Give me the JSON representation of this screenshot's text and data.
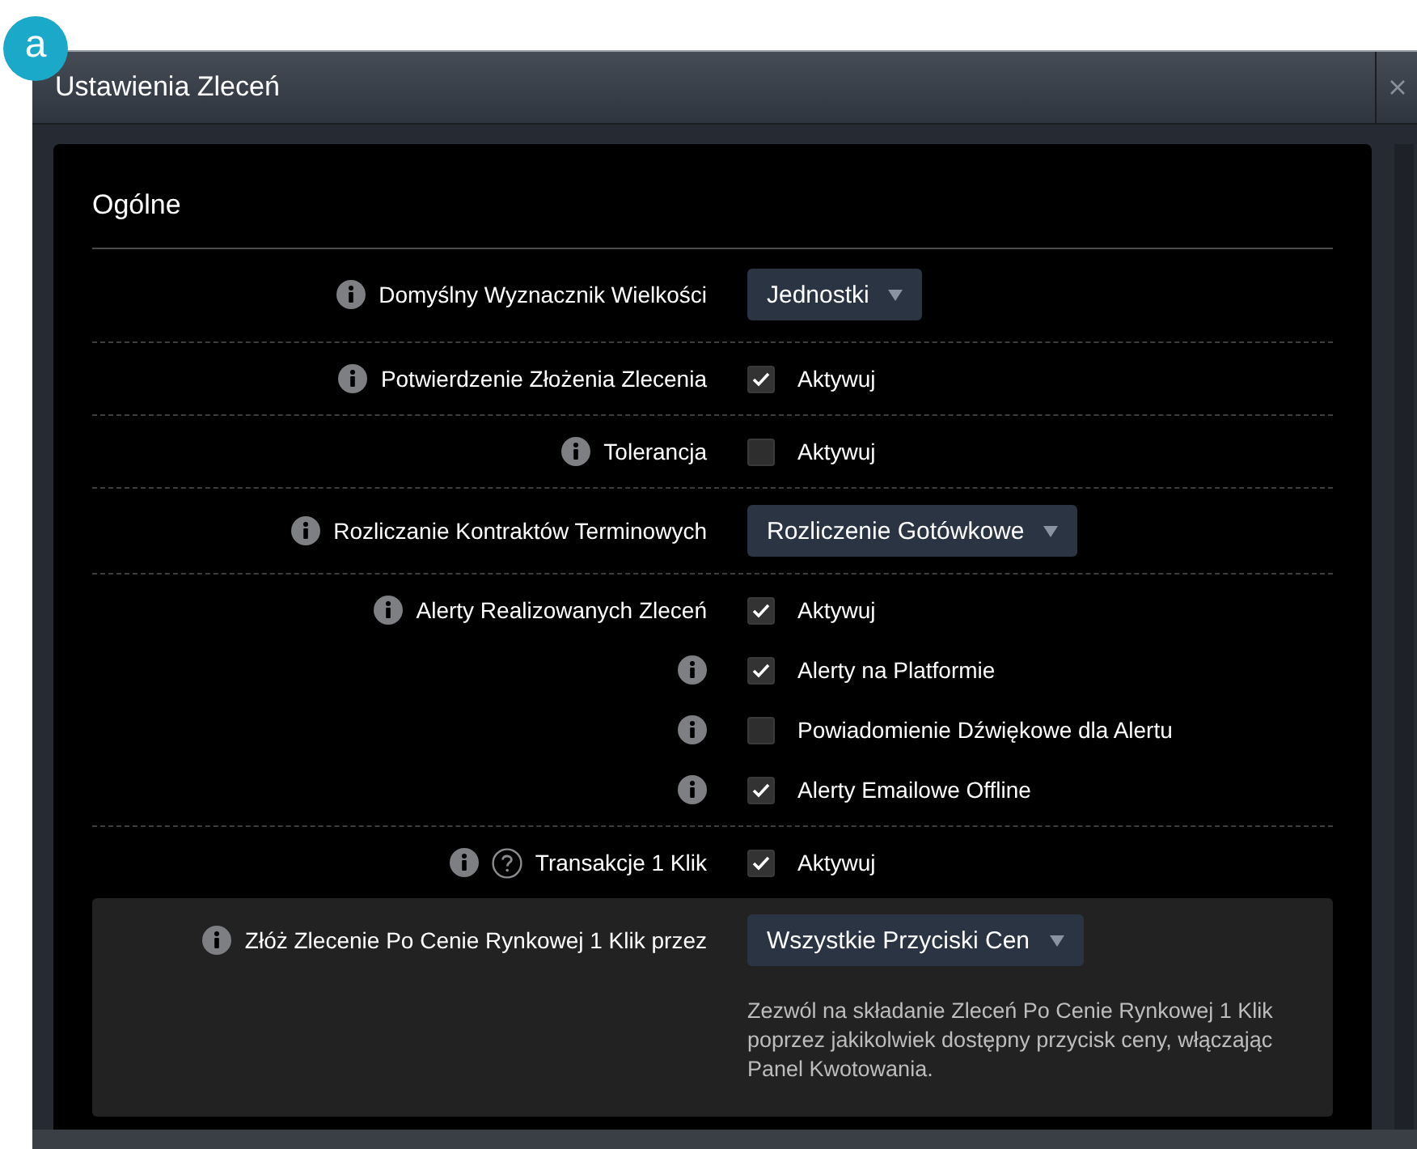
{
  "badge": "a",
  "window": {
    "title": "Ustawienia Zleceń"
  },
  "section": {
    "title": "Ogólne"
  },
  "groups": [
    {
      "highlighted": false,
      "items": [
        {
          "kind": "select",
          "label": "Domyślny Wyznacznik Wielkości",
          "info": true,
          "help": false,
          "value": "Jednostki"
        }
      ]
    },
    {
      "highlighted": false,
      "items": [
        {
          "kind": "checkbox",
          "label": "Potwierdzenie Złożenia Zlecenia",
          "info": true,
          "help": false,
          "checked": true,
          "text": "Aktywuj"
        }
      ]
    },
    {
      "highlighted": false,
      "items": [
        {
          "kind": "checkbox",
          "label": "Tolerancja",
          "info": true,
          "help": false,
          "checked": false,
          "text": "Aktywuj"
        }
      ]
    },
    {
      "highlighted": false,
      "items": [
        {
          "kind": "select",
          "label": "Rozliczanie Kontraktów Terminowych",
          "info": true,
          "help": false,
          "value": "Rozliczenie Gotówkowe"
        }
      ]
    },
    {
      "highlighted": false,
      "items": [
        {
          "kind": "checkbox",
          "label": "Alerty Realizowanych Zleceń",
          "info": true,
          "help": false,
          "checked": true,
          "text": "Aktywuj"
        },
        {
          "kind": "checkbox",
          "info": true,
          "help": false,
          "checked": true,
          "text": "Alerty na Platformie"
        },
        {
          "kind": "checkbox",
          "info": true,
          "help": false,
          "checked": false,
          "text": "Powiadomienie Dźwiękowe dla Alertu"
        },
        {
          "kind": "checkbox",
          "info": true,
          "help": false,
          "checked": true,
          "text": "Alerty Emailowe Offline"
        }
      ]
    },
    {
      "highlighted": false,
      "items": [
        {
          "kind": "checkbox",
          "label": "Transakcje 1 Klik",
          "info": true,
          "help": true,
          "checked": true,
          "text": "Aktywuj"
        }
      ]
    },
    {
      "highlighted": true,
      "items": [
        {
          "kind": "select",
          "label": "Złóż Zlecenie Po Cenie Rynkowej 1 Klik przez",
          "info": true,
          "help": false,
          "value": "Wszystkie Przyciski Cen"
        }
      ],
      "description": "Zezwól na składanie Zleceń Po Cenie Rynkowej 1 Klik poprzez jakikolwiek dostępny przycisk ceny, włączając Panel Kwotowania."
    }
  ]
}
